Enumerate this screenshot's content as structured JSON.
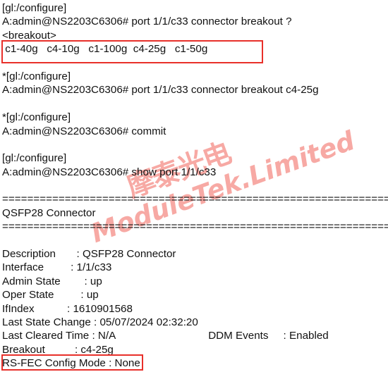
{
  "meta": {
    "app": "Nokia SR Linux CLI terminal transcript",
    "background_color": "#ffffff",
    "text_color": "#111111",
    "highlight_color": "#e8302a",
    "watermark_color": "#f7a9a4"
  },
  "watermark": {
    "line_cn": "摩泰光电",
    "line_en": "ModuleTek.Limited",
    "rotation_degrees": -20
  },
  "session": {
    "prompt_context_1": "[gl:/configure]",
    "prompt_1": "A:admin@NS2203C6306# port 1/1/c33 connector breakout ?",
    "help_header": "<breakout>",
    "breakout_options": "c1-40g   c4-10g   c1-100g  c4-25g   c1-50g",
    "breakout_option_list": [
      "c1-40g",
      "c4-10g",
      "c1-100g",
      "c4-25g",
      "c1-50g"
    ],
    "prompt_context_2": "*[gl:/configure]",
    "prompt_2": "A:admin@NS2203C6306# port 1/1/c33 connector breakout c4-25g",
    "prompt_context_3": "*[gl:/configure]",
    "prompt_3": "A:admin@NS2203C6306# commit",
    "prompt_context_4": "[gl:/configure]",
    "prompt_4": "A:admin@NS2203C6306# show port 1/1/c33"
  },
  "output": {
    "separator_equals": "================================================================================",
    "section_title": "QSFP28 Connector",
    "rows": [
      {
        "label": "Description",
        "value": ": QSFP28 Connector"
      },
      {
        "label": "Interface",
        "value": ": 1/1/c33"
      },
      {
        "label": "Admin State",
        "value": ": up"
      },
      {
        "label": "Oper State",
        "value": ": up"
      },
      {
        "label": "IfIndex",
        "value": ": 1610901568"
      },
      {
        "label": "Last State Change",
        "value": ": 05/07/2024 02:32:20"
      }
    ],
    "row_last_cleared": {
      "label": "Last Cleared Time",
      "value": ": N/A",
      "right_label": "DDM Events",
      "right_value": ": Enabled"
    },
    "row_breakout": {
      "label": "Breakout",
      "value": ": c4-25g"
    },
    "row_rsfec": {
      "label": "RS-FEC Config Mode",
      "value": ": None"
    }
  },
  "lines": {
    "l01": "[gl:/configure]",
    "l02": "A:admin@NS2203C6306# port 1/1/c33 connector breakout ?",
    "l03": "<breakout>",
    "l04": " c1-40g   c4-10g   c1-100g  c4-25g   c1-50g",
    "l06": "*[gl:/configure]",
    "l07": "A:admin@NS2203C6306# port 1/1/c33 connector breakout c4-25g",
    "l09": "*[gl:/configure]",
    "l10": "A:admin@NS2203C6306# commit",
    "l12": "[gl:/configure]",
    "l13": "A:admin@NS2203C6306# show port 1/1/c33",
    "l15": "================================================================================",
    "l16": "QSFP28 Connector",
    "l17": "================================================================================",
    "l18": "Description       : QSFP28 Connector",
    "l19": "Interface         : 1/1/c33",
    "l20": "Admin State        : up",
    "l21": "Oper State         : up",
    "l22": "IfIndex           : 1610901568",
    "l23": "Last State Change : 05/07/2024 02:32:20",
    "l24a": "Last Cleared Time : N/A",
    "l24b": "DDM Events     : Enabled",
    "l25": "Breakout          : c4-25g",
    "l26": "RS-FEC Config Mode : None"
  }
}
